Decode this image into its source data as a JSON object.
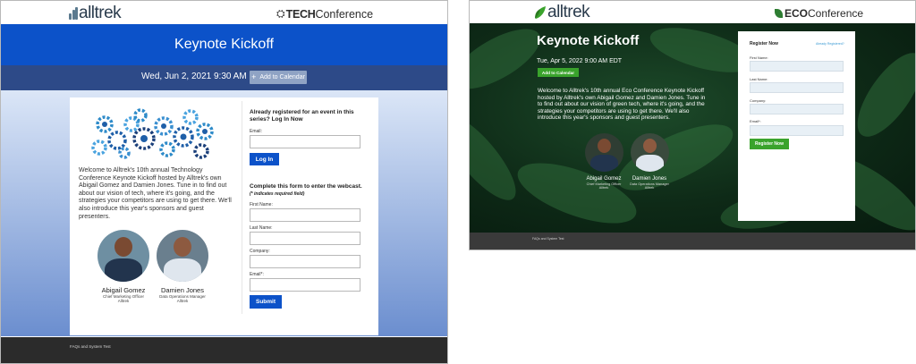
{
  "brand": {
    "name": "alltrek"
  },
  "tech": {
    "conference_prefix": "TECH",
    "conference_suffix": "Conference",
    "title": "Keynote Kickoff",
    "date": "Wed, Jun 2, 2021 9:30 AM EDT",
    "add_to_calendar": "Add to Calendar",
    "intro": "Welcome to Alltrek's 10th annual Technology Conference Keynote Kickoff hosted by Alltrek's own Abigail Gomez and Damien Jones. Tune in to find out about our vision of tech, where it's going, and the strategies your competitors are using to get there. We'll also introduce this year's sponsors and guest presenters.",
    "speakers": [
      {
        "name": "Abigail Gomez",
        "title": "Chief Marketing Officer",
        "company": "Alltrek"
      },
      {
        "name": "Damien Jones",
        "title": "Data Operations Manager",
        "company": "Alltrek"
      }
    ],
    "login": {
      "heading": "Already registered for an event in this series? Log In Now",
      "email_label": "Email:",
      "button": "Log In"
    },
    "register": {
      "heading": "Complete this form to enter the webcast.",
      "required_note": "(* indicates required field)",
      "first_name_label": "First Name:",
      "last_name_label": "Last Name:",
      "company_label": "Company:",
      "email_label": "Email*:",
      "button": "Submit"
    },
    "footer_link": "FAQs and System Test",
    "colors": {
      "band": "#0c52c9",
      "date_band": "#2d4a88"
    }
  },
  "eco": {
    "conference_prefix": "ECO",
    "conference_suffix": "Conference",
    "title": "Keynote Kickoff",
    "date": "Tue, Apr 5, 2022 9:00 AM EDT",
    "add_to_calendar": "Add to Calendar",
    "intro": "Welcome to Alltrek's 10th annual Eco Conference Keynote Kickoff hosted by Alltrek's own Abigail Gomez and Damien Jones. Tune in to find out about our vision of green tech, where it's going, and the strategies your competitors are using to get there. We'll also introduce this year's sponsors and guest presenters.",
    "speakers": [
      {
        "name": "Abigail Gomez",
        "title": "Chief Marketing Officer",
        "company": "Alltrek"
      },
      {
        "name": "Damien Jones",
        "title": "Data Operations Manager",
        "company": "Alltrek"
      }
    ],
    "register": {
      "heading": "Register Now",
      "already": "Already Registered?",
      "first_name_label": "First Name:",
      "last_name_label": "Last Name:",
      "company_label": "Company:",
      "email_label": "Email*:",
      "button": "Register Now"
    },
    "footer_link": "FAQs and System Test",
    "colors": {
      "accent": "#3aa32c"
    }
  }
}
